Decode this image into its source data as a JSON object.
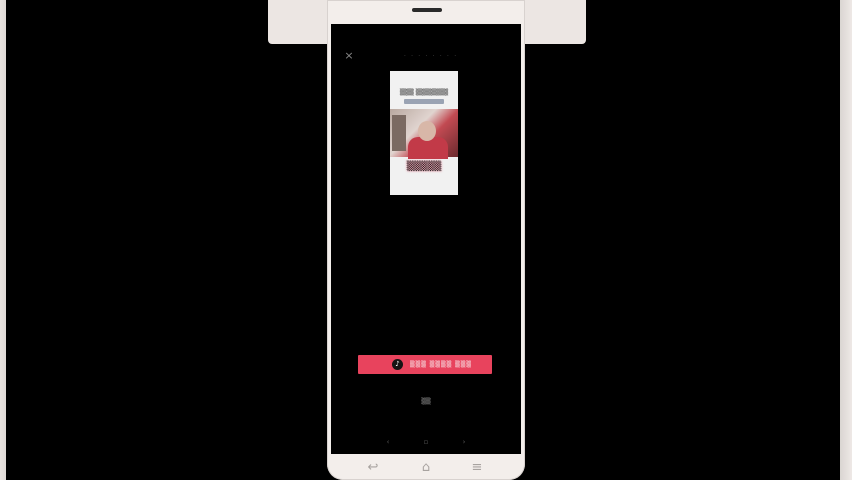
{
  "header": {
    "close_glyph": "×",
    "title": "· · · · · · · ·"
  },
  "cover": {
    "headline": "▒▒▒ ▒▒▒▒▒▒▒",
    "caption": "▒▒▒▒▒"
  },
  "actions": {
    "primary_icon": "♪",
    "primary_label": "▒▒▒ ▒▒▒▒ ▒▒▒",
    "secondary_label": "▒▒"
  },
  "softnav": {
    "left": "‹",
    "center": "▫",
    "right": "›"
  },
  "hardware_nav": {
    "back": "↩",
    "home": "⌂",
    "menu": "≡"
  },
  "colors": {
    "accent": "#e8435d",
    "screen": "#000000",
    "phone_body": "#f3eeeb"
  }
}
